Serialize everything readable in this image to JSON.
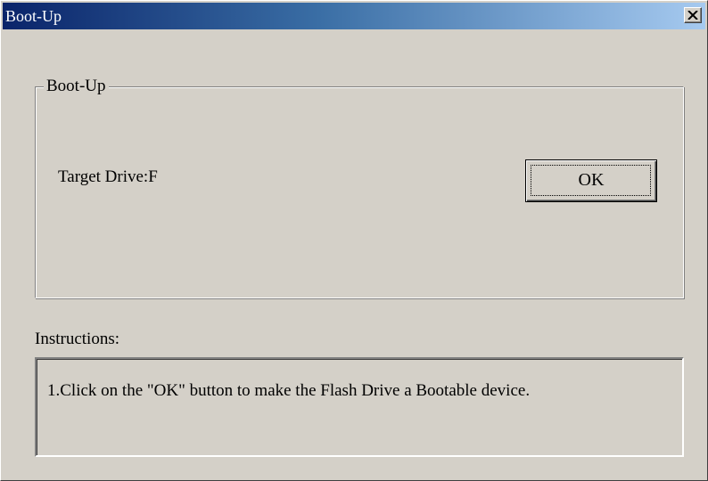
{
  "window": {
    "title": "Boot-Up",
    "close_icon": "close-icon",
    "title_gradient": [
      "#0a246a",
      "#a6caf0"
    ],
    "face_color": "#d4d0c8"
  },
  "groupbox": {
    "legend": "Boot-Up",
    "target_drive_label": "Target Drive:F",
    "ok_label": "OK"
  },
  "instructions": {
    "label": "Instructions:",
    "text": "1.Click on the \"OK\" button to make the Flash Drive a Bootable device."
  }
}
